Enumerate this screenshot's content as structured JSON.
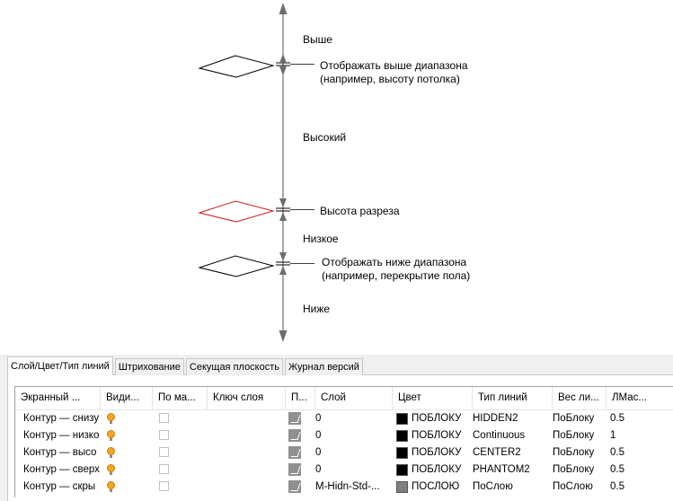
{
  "diagram": {
    "labels": {
      "above": "Выше",
      "display_above": "Отображать выше диапазона",
      "display_above_note": "(например, высоту потолка)",
      "high": "Высокий",
      "cut_height": "Высота разреза",
      "low": "Низкое",
      "display_below": "Отображать ниже диапазона",
      "display_below_note": "(например, перекрытие пола)",
      "below": "Ниже"
    },
    "colors": {
      "cut_plane": "#d11a1a",
      "line": "#000000",
      "axis": "#6d6d6d"
    }
  },
  "tabs": [
    {
      "label": "Слой/Цвет/Тип линий",
      "active": true
    },
    {
      "label": "Штрихование",
      "active": false
    },
    {
      "label": "Секущая плоскость",
      "active": false
    },
    {
      "label": "Журнал версий",
      "active": false
    }
  ],
  "table": {
    "columns": [
      "Экранный ...",
      "Види...",
      "По ма...",
      "Ключ слоя",
      "П...",
      "Слой",
      "Цвет",
      "Тип линий",
      "Вес ли...",
      "ЛМас..."
    ],
    "rows": [
      {
        "name": "Контур — снизу",
        "layer": "0",
        "color_swatch": "#000000",
        "color": "ПОБЛОКУ",
        "linetype": "HIDDEN2",
        "weight": "ПоБлоку",
        "scale": "0.5"
      },
      {
        "name": "Контур — низко",
        "layer": "0",
        "color_swatch": "#000000",
        "color": "ПОБЛОКУ",
        "linetype": "Continuous",
        "weight": "ПоБлоку",
        "scale": "1"
      },
      {
        "name": "Контур — высо",
        "layer": "0",
        "color_swatch": "#000000",
        "color": "ПОБЛОКУ",
        "linetype": "CENTER2",
        "weight": "ПоБлоку",
        "scale": "0.5"
      },
      {
        "name": "Контур — сверх",
        "layer": "0",
        "color_swatch": "#000000",
        "color": "ПОБЛОКУ",
        "linetype": "PHANTOM2",
        "weight": "ПоБлоку",
        "scale": "0.5"
      },
      {
        "name": "Контур — скры",
        "layer": "M-Hidn-Std-...",
        "color_swatch": "#808080",
        "color": "ПОСЛОЮ",
        "linetype": "ПоСлою",
        "weight": "ПоСлою",
        "scale": "0.5"
      }
    ],
    "icons": {
      "visible": "lightbulb-on-icon",
      "plot": "plot-pen-icon"
    }
  }
}
